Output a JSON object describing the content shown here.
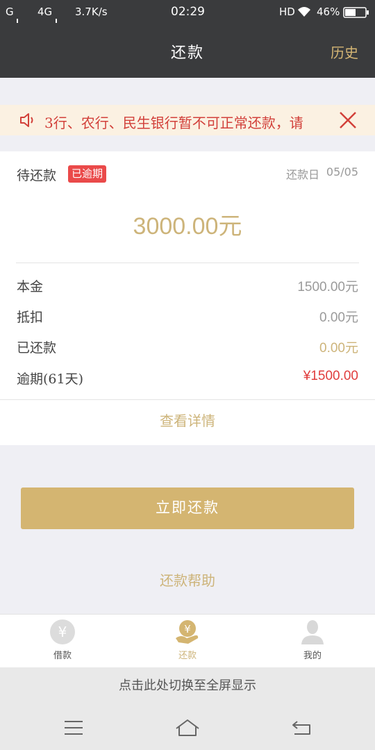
{
  "status_bar": {
    "carrier1": "G",
    "carrier2": "4G",
    "speed": "3.7K/s",
    "time": "02:29",
    "hd": "HD",
    "battery": "46%"
  },
  "header": {
    "title": "还款",
    "history_label": "历史"
  },
  "notice": {
    "text": "3行、农行、民生银行暂不可正常还款，请"
  },
  "card": {
    "due_label": "待还款",
    "overdue_badge": "已逾期",
    "due_date_label": "还款日",
    "due_date": "05/05",
    "amount": "3000.00元",
    "rows": [
      {
        "label": "本金",
        "value": "1500.00元",
        "color": "#9a9a9a"
      },
      {
        "label": "抵扣",
        "value": "0.00元",
        "color": "#9a9a9a"
      },
      {
        "label": "已还款",
        "value": "0.00元",
        "color": "#cdb47a"
      },
      {
        "label": "逾期(61天)",
        "value": "¥1500.00",
        "color": "#e03c3c"
      }
    ],
    "details_link": "查看详情"
  },
  "actions": {
    "pay_button": "立即还款",
    "help_link": "还款帮助"
  },
  "tabbar": {
    "items": [
      {
        "label": "借款",
        "icon": "yuan-coin-icon",
        "active": false
      },
      {
        "label": "还款",
        "icon": "yuan-hand-icon",
        "active": true
      },
      {
        "label": "我的",
        "icon": "person-icon",
        "active": false
      }
    ]
  },
  "fullscreen_hint": "点击此处切换至全屏显示",
  "colors": {
    "accent": "#d4b571",
    "header_bg": "#3a3b3d",
    "overdue_red": "#ea4a4a",
    "notice_bg": "#fbf1e2"
  }
}
